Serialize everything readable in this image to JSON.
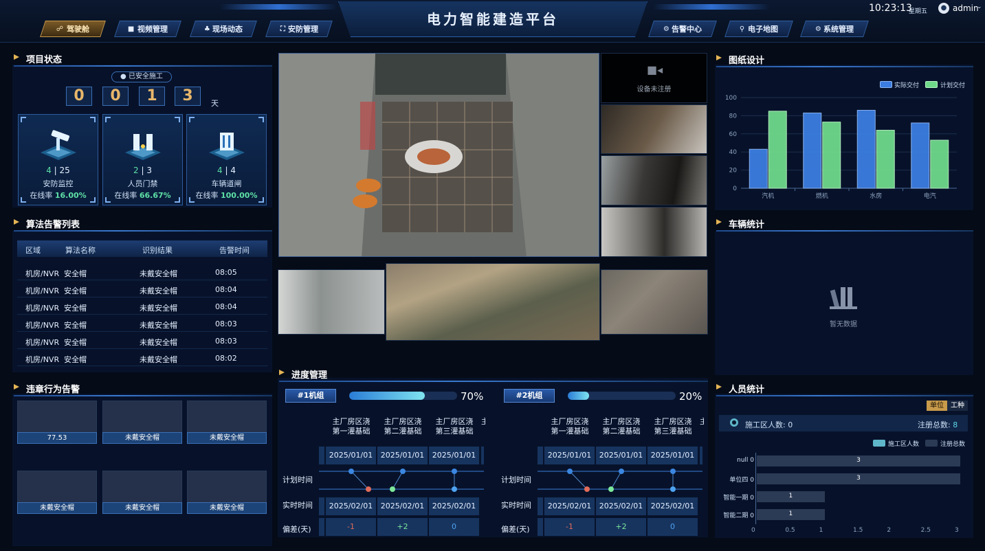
{
  "header": {
    "title": "电力智能建造平台",
    "clock": "10:23:13",
    "weekday": "星期五",
    "user": "admin",
    "nav_left": [
      {
        "label": "驾驶舱",
        "active": true,
        "icon": "cockpit-icon"
      },
      {
        "label": "视频管理",
        "active": false,
        "icon": "video-icon"
      },
      {
        "label": "现场动态",
        "active": false,
        "icon": "site-icon"
      },
      {
        "label": "安防管理",
        "active": false,
        "icon": "security-icon"
      }
    ],
    "nav_right": [
      {
        "label": "告警中心",
        "active": false,
        "icon": "alarm-icon"
      },
      {
        "label": "电子地图",
        "active": false,
        "icon": "map-icon"
      },
      {
        "label": "系统管理",
        "active": false,
        "icon": "settings-icon"
      }
    ]
  },
  "project_status": {
    "title": "项目状态",
    "badge": "已安全施工",
    "days_digits": [
      "0",
      "0",
      "1",
      "3"
    ],
    "day_unit": "天",
    "cards": [
      {
        "online": "4",
        "total": "25",
        "name": "安防监控",
        "rate_label": "在线率",
        "rate": "16.00%",
        "icon": "surveillance-camera-icon"
      },
      {
        "online": "2",
        "total": "3",
        "name": "人员门禁",
        "rate_label": "在线率",
        "rate": "66.67%",
        "icon": "access-gate-icon"
      },
      {
        "online": "4",
        "total": "4",
        "name": "车辆道闸",
        "rate_label": "在线率",
        "rate": "100.00%",
        "icon": "vehicle-barrier-icon"
      }
    ]
  },
  "alarm_list": {
    "title": "算法告警列表",
    "headers": [
      "区域",
      "算法名称",
      "识别结果",
      "告警时间"
    ],
    "rows": [
      [
        "机房/NVR",
        "安全帽",
        "未戴安全帽",
        "08:05"
      ],
      [
        "机房/NVR",
        "安全帽",
        "未戴安全帽",
        "08:04"
      ],
      [
        "机房/NVR",
        "安全帽",
        "未戴安全帽",
        "08:04"
      ],
      [
        "机房/NVR",
        "安全帽",
        "未戴安全帽",
        "08:03"
      ],
      [
        "机房/NVR",
        "安全帽",
        "未戴安全帽",
        "08:03"
      ],
      [
        "机房/NVR",
        "安全帽",
        "未戴安全帽",
        "08:02"
      ]
    ]
  },
  "violations": {
    "title": "违章行为告警",
    "items": [
      "77.53",
      "未戴安全帽",
      "未戴安全帽",
      "未戴安全帽",
      "未戴安全帽",
      "未戴安全帽"
    ]
  },
  "video": {
    "unregistered": "设备未注册"
  },
  "progress": {
    "title": "进度管理",
    "row_labels": {
      "plan": "计划时间",
      "actual": "实时时间",
      "deviation": "偏差(天)"
    },
    "units": [
      {
        "name": "#1机组",
        "percent": 70,
        "percent_label": "70%",
        "stages": [
          "主厂房区浇\n第一灌基础",
          "主厂房区浇\n第二灌基础",
          "主厂房区浇\n第三灌基础"
        ],
        "plan": [
          "2025/01/01",
          "2025/01/01",
          "2025/01/01"
        ],
        "actual": [
          "2025/02/01",
          "2025/02/01",
          "2025/02/01"
        ],
        "deviation": [
          "-1",
          "+2",
          "0"
        ]
      },
      {
        "name": "#2机组",
        "percent": 20,
        "percent_label": "20%",
        "stages": [
          "主厂房区浇\n第一灌基础",
          "主厂房区浇\n第二灌基础",
          "主厂房区浇\n第三灌基础"
        ],
        "plan": [
          "2025/01/01",
          "2025/01/01",
          "2025/01/01"
        ],
        "actual": [
          "2025/02/01",
          "2025/02/01",
          "2025/02/01"
        ],
        "deviation": [
          "-1",
          "+2",
          "0"
        ]
      }
    ],
    "colors": {
      "negative": "#e36b5a",
      "positive": "#7de89a",
      "zero": "#4ea3f0"
    }
  },
  "drawing_design": {
    "title": "图纸设计",
    "chart_data": {
      "type": "bar",
      "categories": [
        "汽机",
        "燃机",
        "水房",
        "电汽"
      ],
      "series": [
        {
          "name": "实际交付",
          "values": [
            43,
            83,
            86,
            72
          ],
          "color": "#3b7de0"
        },
        {
          "name": "计划交付",
          "values": [
            85,
            73,
            64,
            53
          ],
          "color": "#6fd98a"
        }
      ],
      "yticks": [
        "0",
        "20",
        "40",
        "60",
        "80",
        "100"
      ],
      "ylim": [
        0,
        100
      ],
      "legend": "top-right"
    }
  },
  "vehicle_stats": {
    "title": "车辆统计",
    "empty": "暂无数据"
  },
  "personnel_stats": {
    "title": "人员统计",
    "toggle": [
      "单位",
      "工种"
    ],
    "site_count_label": "施工区人数:",
    "site_count": "0",
    "registered_label": "注册总数:",
    "registered": "8",
    "chart_data": {
      "type": "bar",
      "orientation": "horizontal",
      "categories": [
        "null",
        "单位四",
        "智能一期",
        "智能二期"
      ],
      "series": [
        {
          "name": "施工区人数",
          "values": [
            0,
            0,
            0,
            0
          ],
          "color": "#5fb6c9"
        },
        {
          "name": "注册总数",
          "values": [
            3,
            3,
            1,
            1
          ],
          "color": "#2c3b55"
        }
      ],
      "xticks": [
        "0",
        "0.5",
        "1",
        "1.5",
        "2",
        "2.5",
        "3"
      ],
      "xlim": [
        0,
        3
      ],
      "legend": "top-right"
    }
  }
}
